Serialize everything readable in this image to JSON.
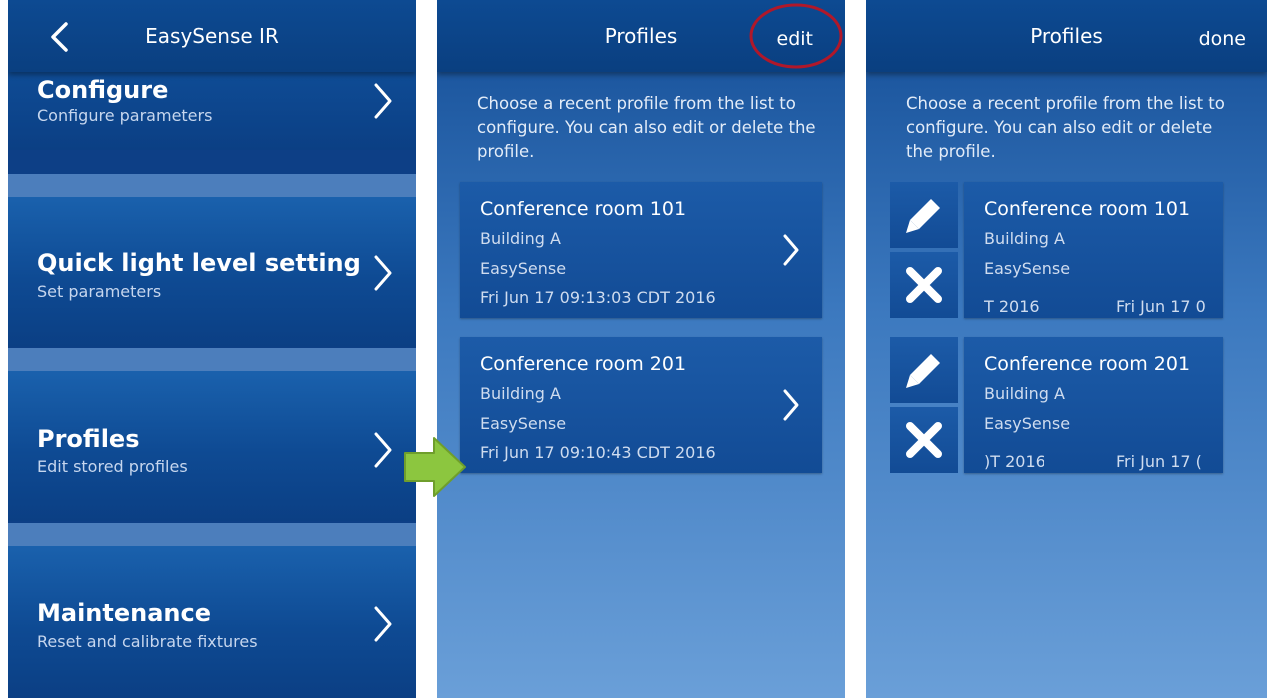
{
  "screen1": {
    "title": "EasySense IR",
    "items": [
      {
        "title": "Configure",
        "subtitle": "Configure parameters"
      },
      {
        "title": "Quick light level setting",
        "subtitle": "Set parameters"
      },
      {
        "title": "Profiles",
        "subtitle": "Edit stored profiles"
      },
      {
        "title": "Maintenance",
        "subtitle": "Reset and calibrate fixtures"
      }
    ]
  },
  "screen2": {
    "title": "Profiles",
    "action": "edit",
    "intro": "Choose a recent profile from the list to configure. You can also edit or delete the profile.",
    "profiles": [
      {
        "name": "Conference room 101",
        "building": "Building A",
        "system": "EasySense",
        "date": "Fri Jun 17 09:13:03 CDT 2016"
      },
      {
        "name": "Conference room 201",
        "building": "Building A",
        "system": "EasySense",
        "date": "Fri Jun 17 09:10:43 CDT 2016"
      }
    ]
  },
  "screen3": {
    "title": "Profiles",
    "action": "done",
    "intro": "Choose a recent profile from the list to configure. You can also edit or delete the profile.",
    "profiles": [
      {
        "name": "Conference room 101",
        "building": "Building A",
        "system": "EasySense",
        "date_tail": "T 2016",
        "date_head": "Fri Jun 17 0"
      },
      {
        "name": "Conference room 201",
        "building": "Building A",
        "system": "EasySense",
        "date_tail": ")T 2016",
        "date_head": "Fri Jun 17 ("
      }
    ]
  },
  "colors": {
    "header": "#0a3f80",
    "row": "#0e4a93",
    "separator": "#4c7ebc",
    "arrow": "#8cc63f",
    "highlight_ring": "#b0182a"
  },
  "icons": [
    "chevron-left-icon",
    "chevron-right-icon",
    "pencil-icon",
    "close-icon",
    "arrow-right-icon"
  ]
}
